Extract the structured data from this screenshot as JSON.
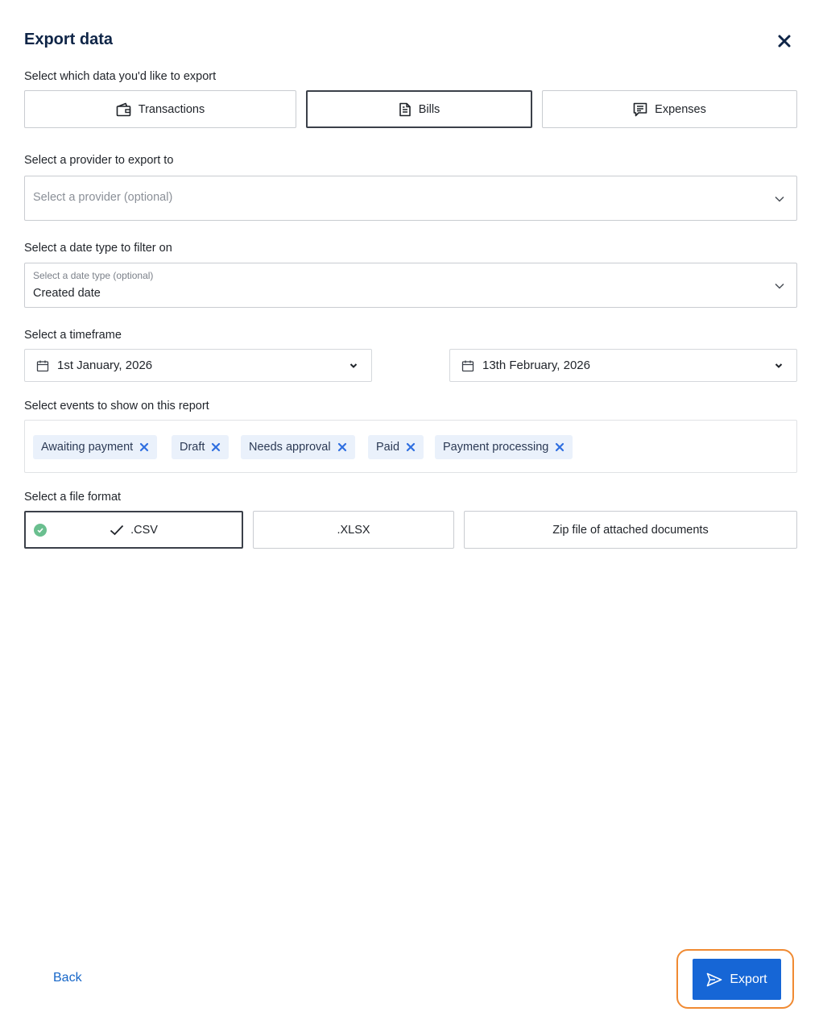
{
  "dialog": {
    "title": "Export data"
  },
  "data_section": {
    "label": "Select which data you'd like to export",
    "options": [
      {
        "label": "Transactions",
        "icon": "wallet-icon",
        "selected": false
      },
      {
        "label": "Bills",
        "icon": "document-icon",
        "selected": true
      },
      {
        "label": "Expenses",
        "icon": "receipt-icon",
        "selected": false
      }
    ]
  },
  "provider": {
    "label": "Select a provider to export to",
    "placeholder": "Select a provider (optional)",
    "value": ""
  },
  "date_type": {
    "label": "Select a date type to filter on",
    "field_label": "Select a date type (optional)",
    "value": "Created date"
  },
  "timeframe": {
    "label": "Select a timeframe",
    "start": "1st January, 2026",
    "end": "13th February, 2026"
  },
  "events": {
    "label": "Select events to show on this report",
    "chips": [
      "Awaiting payment",
      "Draft",
      "Needs approval",
      "Paid",
      "Payment processing"
    ]
  },
  "file_format": {
    "label": "Select a file format",
    "options": [
      {
        "label": ".CSV",
        "selected": true
      },
      {
        "label": ".XLSX",
        "selected": false
      },
      {
        "label": "Zip file of attached documents",
        "selected": false
      }
    ]
  },
  "footer": {
    "back": "Back",
    "export": "Export"
  },
  "colors": {
    "primary": "#1666d6",
    "title": "#0f2547",
    "chip_bg": "#eaf1fb",
    "chip_x": "#2f6fe0",
    "success": "#6abf8f",
    "focus_ring": "#f08a32"
  }
}
